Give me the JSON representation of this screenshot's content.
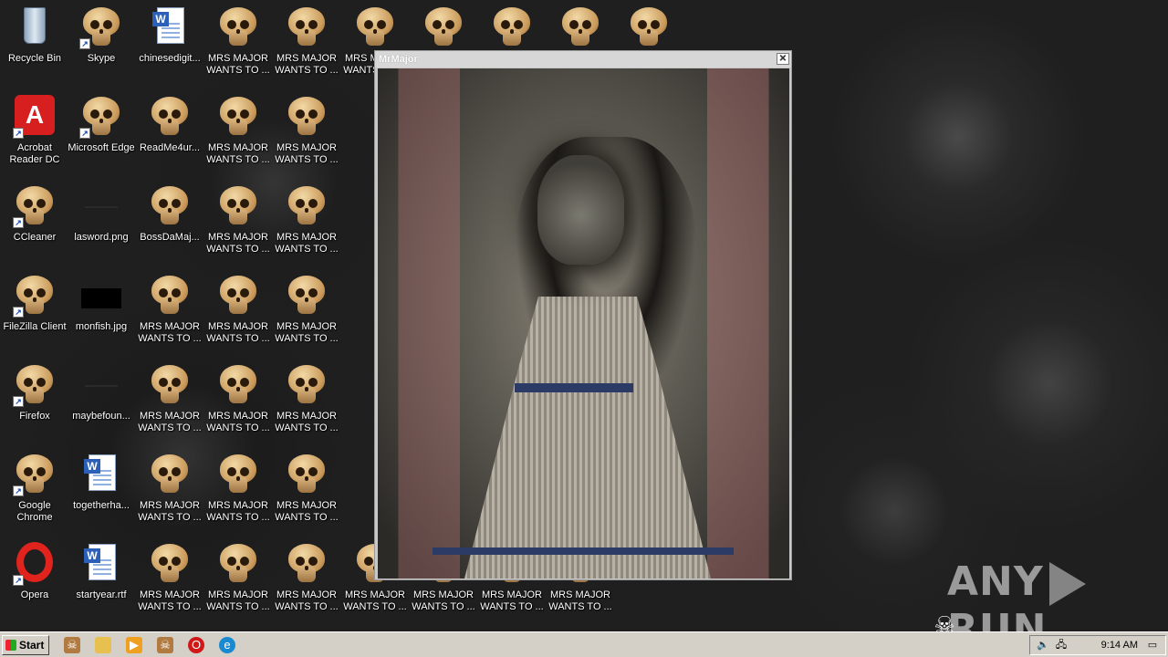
{
  "desktop": {
    "icons": [
      {
        "label": "Recycle Bin"
      },
      {
        "label": "Acrobat\nReader DC"
      },
      {
        "label": "CCleaner"
      },
      {
        "label": "FileZilla Client"
      },
      {
        "label": "Firefox"
      },
      {
        "label": "Google\nChrome"
      },
      {
        "label": "Opera"
      },
      {
        "label": "Skype"
      },
      {
        "label": "Microsoft Edge"
      },
      {
        "label": "lasword.png"
      },
      {
        "label": "monfish.jpg"
      },
      {
        "label": "maybefoun..."
      },
      {
        "label": "togetherha..."
      },
      {
        "label": "startyear.rtf"
      },
      {
        "label": "chinesedigit..."
      },
      {
        "label": "ReadMe4ur..."
      },
      {
        "label": "BossDaMaj..."
      },
      {
        "label": "MRS MAJOR\nWANTS TO ..."
      }
    ]
  },
  "window": {
    "title": "MrMajor",
    "close_glyph": "✕"
  },
  "watermark": {
    "text_left": "ANY",
    "text_right": "RUN"
  },
  "taskbar": {
    "start_label": "Start",
    "clock": "9:14 AM"
  }
}
